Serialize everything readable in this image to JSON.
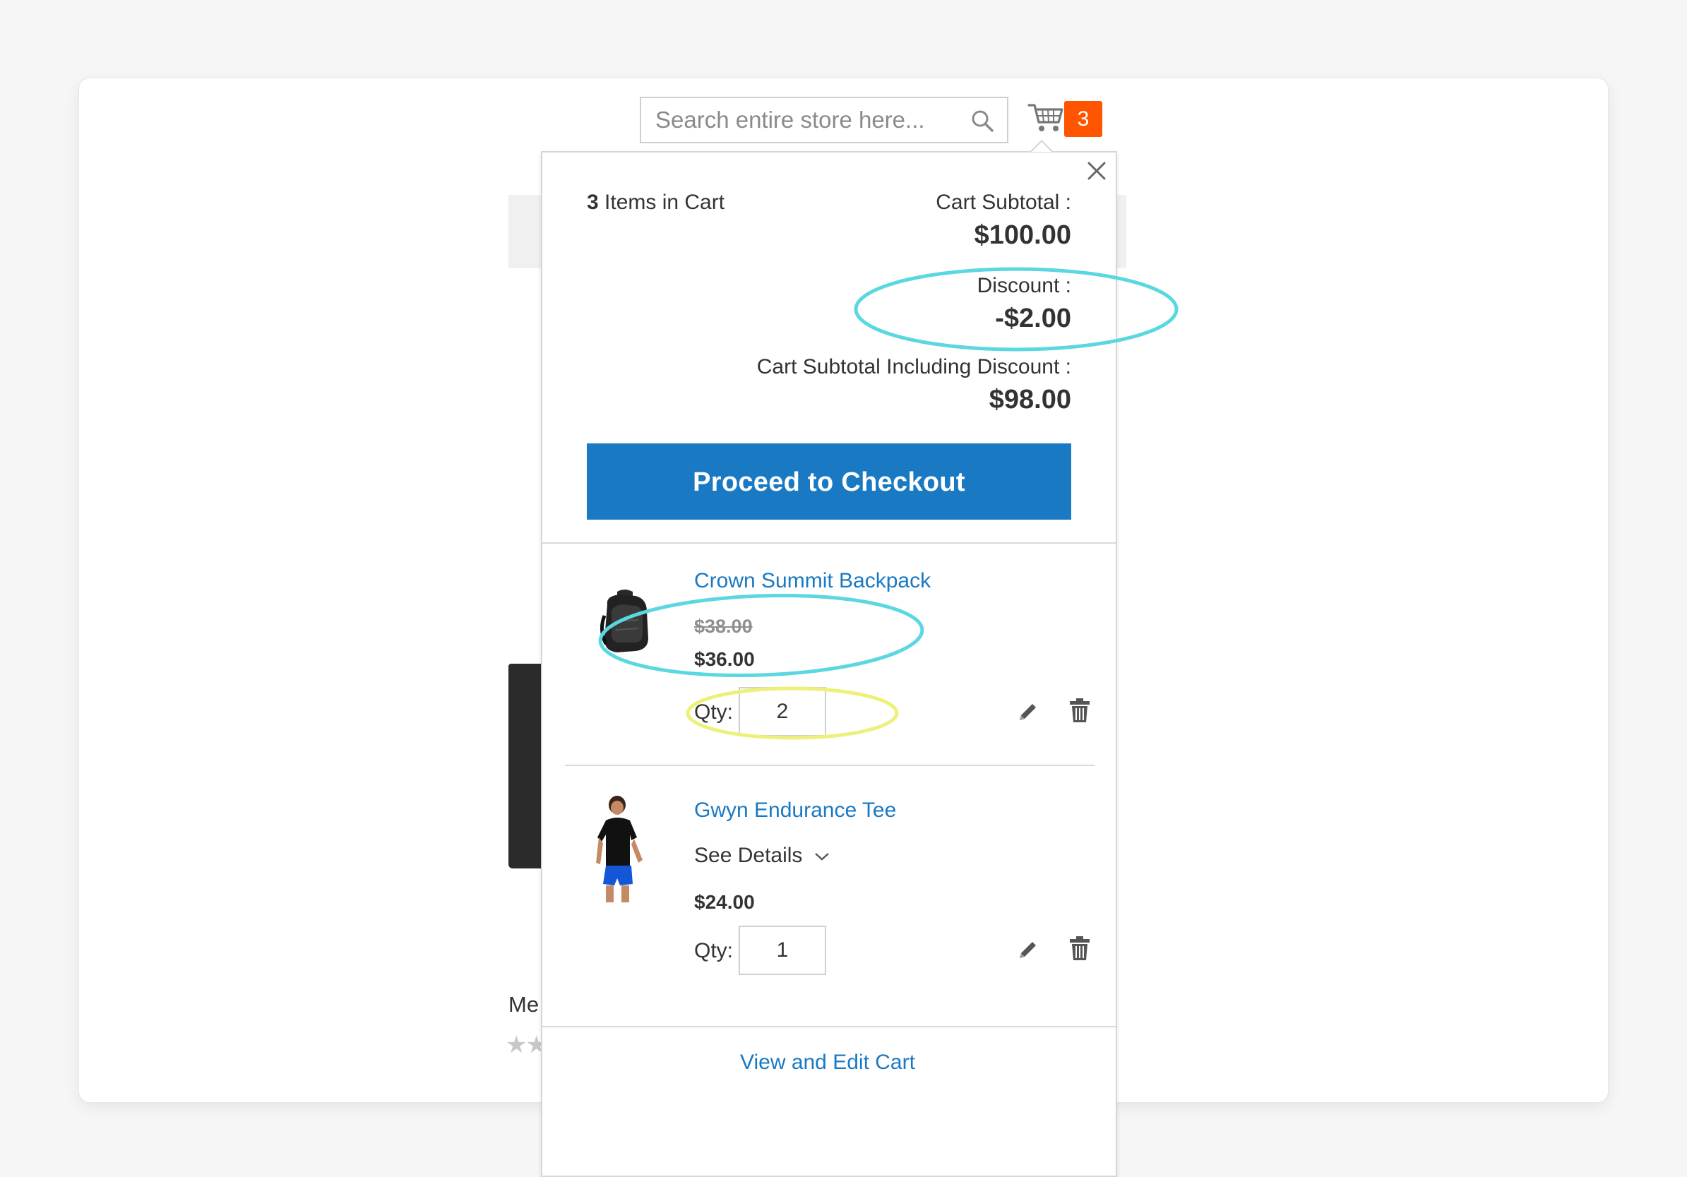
{
  "header": {
    "search_placeholder": "Search entire store here...",
    "cart_count": "3"
  },
  "background_page": {
    "product_name_fragment": "Me",
    "stars": "★★"
  },
  "minicart": {
    "items_count": "3",
    "items_label": " Items in Cart",
    "subtotal_label": "Cart Subtotal :",
    "subtotal_value": "$100.00",
    "discount_label": "Discount :",
    "discount_value": "-$2.00",
    "subtotal_incl_label": "Cart Subtotal Including Discount :",
    "subtotal_incl_value": "$98.00",
    "checkout_label": "Proceed to Checkout",
    "view_edit_label": "View and Edit Cart",
    "items": [
      {
        "name": "Crown Summit Backpack",
        "old_price": "$38.00",
        "price": "$36.00",
        "qty_label": "Qty:",
        "qty": "2"
      },
      {
        "name": "Gwyn Endurance Tee",
        "details_label": "See Details",
        "price": "$24.00",
        "qty_label": "Qty:",
        "qty": "1"
      }
    ]
  },
  "annotations": {
    "highlight_teal": "#5ad7e0",
    "highlight_yellow": "#eef07a"
  },
  "colors": {
    "accent_blue": "#1979c3",
    "badge_orange": "#ff5501"
  }
}
